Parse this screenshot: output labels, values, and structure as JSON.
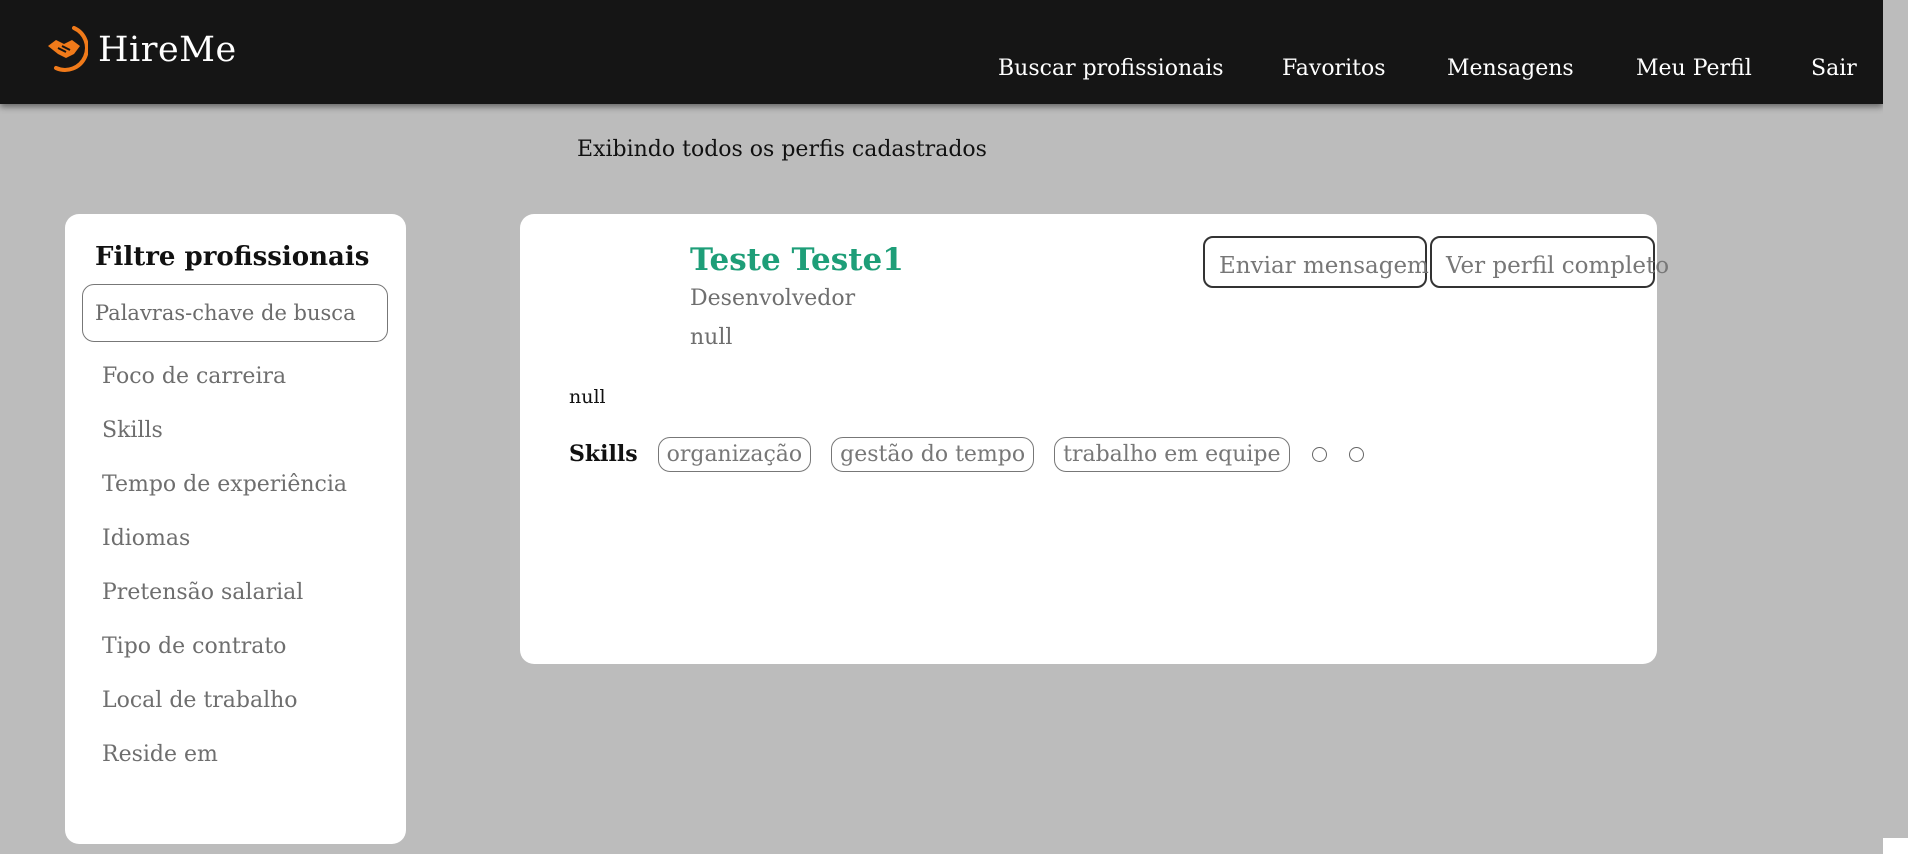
{
  "header": {
    "brand": "HireMe",
    "nav": [
      "Buscar profissionais",
      "Favoritos",
      "Mensagens",
      "Meu Perfil",
      "Sair"
    ]
  },
  "main": {
    "subtitle": "Exibindo todos os perfis cadastrados"
  },
  "filters": {
    "title": "Filtre profissionais",
    "search_placeholder": "Palavras-chave de busca",
    "items": [
      "Foco de carreira",
      "Skills",
      "Tempo de experiência",
      "Idiomas",
      "Pretensão salarial",
      "Tipo de contrato",
      "Local de trabalho",
      "Reside em"
    ]
  },
  "profile": {
    "name": "Teste Teste1",
    "role": "Desenvolvedor",
    "location": "null",
    "bio": "null",
    "skills_label": "Skills",
    "skills": [
      "organização",
      "gestão do tempo",
      "trabalho em equipe"
    ],
    "empty_skill_dots": 2,
    "message_button": "Enviar mensagem",
    "profile_button": "Ver perfil completo"
  },
  "colors": {
    "header_bg": "#151515",
    "page_bg": "#bcbcbc",
    "name_accent": "#1e9e78",
    "logo_orange": "#f07a1a"
  }
}
